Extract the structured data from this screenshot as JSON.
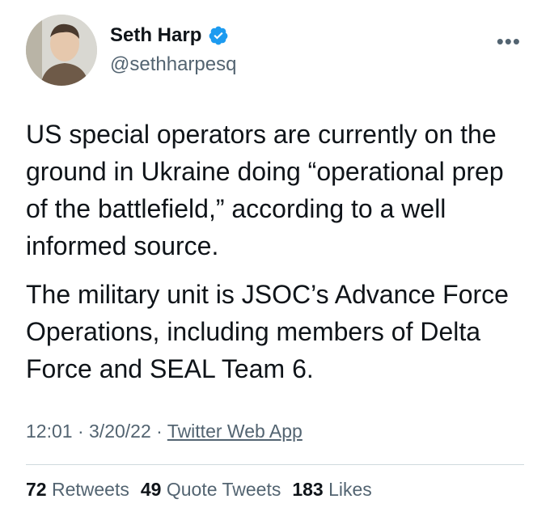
{
  "author": {
    "name": "Seth Harp",
    "handle": "@sethharpesq",
    "verified": true
  },
  "menu": {
    "more_label": "•••"
  },
  "tweet": {
    "paragraphs": [
      "US special operators are currently on the ground in Ukraine doing “operational prep of the battlefield,” according to a well informed source.",
      "The military unit is JSOC’s Advance Force Operations, including members of Delta Force and SEAL Team 6."
    ]
  },
  "meta": {
    "time": "12:01",
    "sep1": " · ",
    "date": "3/20/22",
    "sep2": " · ",
    "source": "Twitter Web App"
  },
  "stats": {
    "retweets_count": "72",
    "retweets_label": "Retweets",
    "quotes_count": "49",
    "quotes_label": "Quote Tweets",
    "likes_count": "183",
    "likes_label": "Likes"
  },
  "colors": {
    "verified_blue": "#1d9bf0",
    "secondary_text": "#536471",
    "primary_text": "#0f1419"
  }
}
